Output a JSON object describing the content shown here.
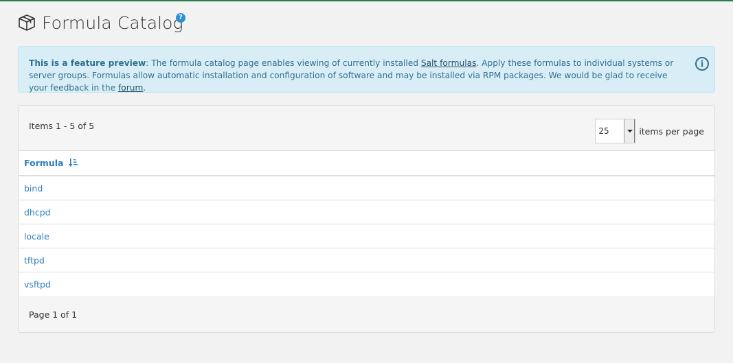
{
  "header": {
    "title": "Formula Catalog",
    "help_glyph": "?",
    "icon": "package-icon"
  },
  "alert": {
    "strong": "This is a feature preview",
    "text1": ": The formula catalog page enables viewing of currently installed ",
    "link1": "Salt formulas",
    "text2": ". Apply these formulas to individual systems or server groups. Formulas allow automatic installation and configuration of software and may be installed via RPM packages. We would be glad to receive your feedback in the ",
    "link2": "forum",
    "text3": ".",
    "icon": "info-icon",
    "icon_glyph": "i"
  },
  "list": {
    "items_count": "Items 1 - 5 of 5",
    "per_page_value": "25",
    "per_page_label": "items per page",
    "column_header": "Formula",
    "rows": [
      "bind",
      "dhcpd",
      "locale",
      "tftpd",
      "vsftpd"
    ],
    "footer": "Page 1 of 1"
  },
  "colors": {
    "accent": "#2d7fc0",
    "alert_bg": "#d9edf7",
    "alert_text": "#31708f",
    "top_line": "#2c7a4b"
  }
}
